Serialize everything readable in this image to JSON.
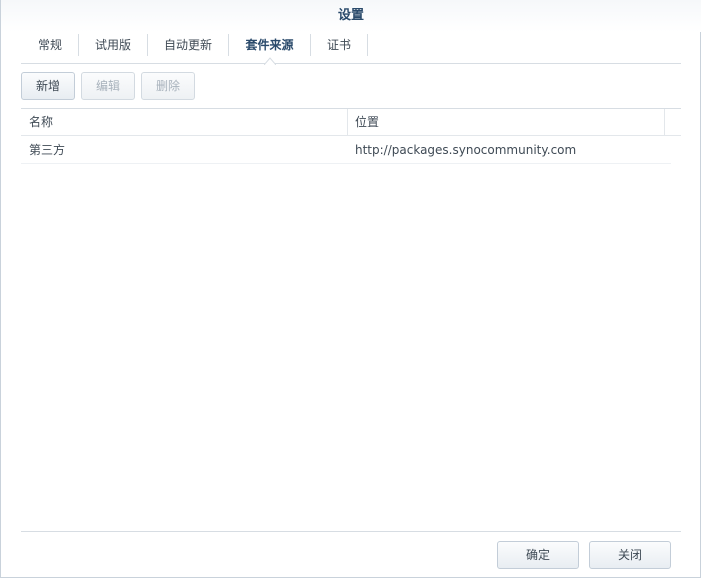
{
  "window": {
    "title": "设置"
  },
  "tabs": [
    {
      "label": "常规"
    },
    {
      "label": "试用版"
    },
    {
      "label": "自动更新"
    },
    {
      "label": "套件来源",
      "active": true
    },
    {
      "label": "证书"
    }
  ],
  "toolbar": {
    "add_label": "新增",
    "edit_label": "编辑",
    "delete_label": "删除"
  },
  "grid": {
    "columns": [
      "名称",
      "位置"
    ],
    "rows": [
      {
        "name": "第三方",
        "location": "http://packages.synocommunity.com"
      }
    ]
  },
  "footer": {
    "ok_label": "确定",
    "close_label": "关闭"
  },
  "colors": {
    "title_text": "#2a4a6b",
    "border": "#d7dde3",
    "disabled_text": "#a8b2bc"
  }
}
